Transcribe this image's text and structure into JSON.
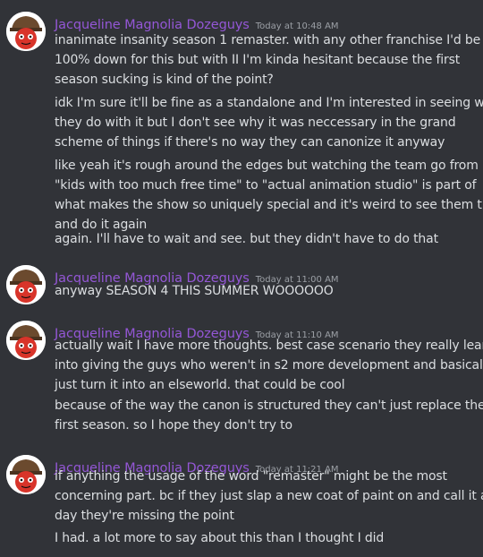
{
  "messages": [
    {
      "author": "Jacqueline Magnolia Dozeguys",
      "timestamp": "Today at 10:48 AM",
      "lines": [
        "inanimate insanity season 1 remaster. with any other franchise I'd be",
        "100% down for this but with II I'm kinda hesitant because the first",
        "season sucking is kind of the point?",
        "idk I'm sure it'll be fine as a standalone and I'm interested in seeing what",
        "they do with it but I don't see why it was neccessary in the grand",
        "scheme of things if there's no way they can canonize it anyway",
        "like yeah it's rough around the edges but watching the team go from",
        "\"kids with too much free time\" to \"actual animation studio\" is part of",
        "what makes the show so uniquely special and it's weird to see them try",
        "and do it again",
        "again. I'll have to wait and see. but they didn't have to do that"
      ]
    },
    {
      "author": "Jacqueline Magnolia Dozeguys",
      "timestamp": "Today at 11:00 AM",
      "lines": [
        "anyway SEASON 4 THIS SUMMER WOOOOOO"
      ]
    },
    {
      "author": "Jacqueline Magnolia Dozeguys",
      "timestamp": "Today at 11:10 AM",
      "lines": [
        "actually wait I have more thoughts. best case scenario they really lean",
        "into giving the guys who weren't in s2 more development and basically",
        "just turn it into an elseworld. that could be cool",
        "because of the way the canon is structured they can't just replace the",
        "first season. so I hope they don't try to"
      ]
    },
    {
      "author": "Jacqueline Magnolia Dozeguys",
      "timestamp": "Today at 11:21 AM",
      "lines": [
        "if anything the usage of the word \"remaster\" might be the most",
        "concerning part. bc if they just slap a new coat of paint on and call it a",
        "day they're missing the point",
        "I had. a lot more to say about this than I thought I did"
      ]
    }
  ]
}
